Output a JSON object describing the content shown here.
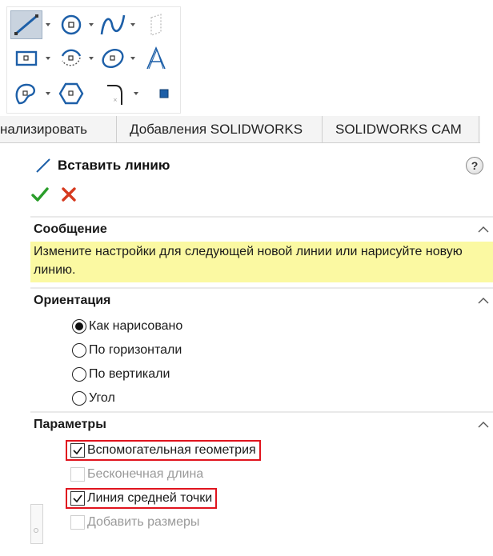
{
  "tabs": [
    "нализировать",
    "Добавления SOLIDWORKS",
    "SOLIDWORKS CAM"
  ],
  "toolbar": {
    "icons": [
      "line-icon",
      "circle-icon",
      "spline-icon",
      "plane-icon",
      "rectangle-icon",
      "arc-icon",
      "ellipse-icon",
      "text-icon",
      "fillet-icon",
      "polygon-icon",
      "trim-icon",
      "point-icon"
    ]
  },
  "property_manager": {
    "title": "Вставить линию",
    "help": "?",
    "message": {
      "header": "Сообщение",
      "text": "Измените настройки для следующей новой линии или нарисуйте новую линию."
    },
    "orientation": {
      "header": "Ориентация",
      "options": [
        "Как нарисовано",
        "По горизонтали",
        "По вертикали",
        "Угол"
      ],
      "selected": "Как нарисовано"
    },
    "parameters": {
      "header": "Параметры",
      "options": [
        {
          "label": "Вспомогательная геометрия",
          "checked": true,
          "enabled": true,
          "highlighted": true
        },
        {
          "label": "Бесконечная длина",
          "checked": false,
          "enabled": false,
          "highlighted": false
        },
        {
          "label": "Линия средней точки",
          "checked": true,
          "enabled": true,
          "highlighted": true
        },
        {
          "label": "Добавить размеры",
          "checked": false,
          "enabled": false,
          "highlighted": false
        }
      ]
    }
  },
  "colors": {
    "message_bg": "#fbf9a2",
    "highlight_border": "#e0141e",
    "ok_green": "#2a9d2a",
    "cancel_red": "#d63a1f",
    "icon_blue": "#1d5fa8"
  }
}
